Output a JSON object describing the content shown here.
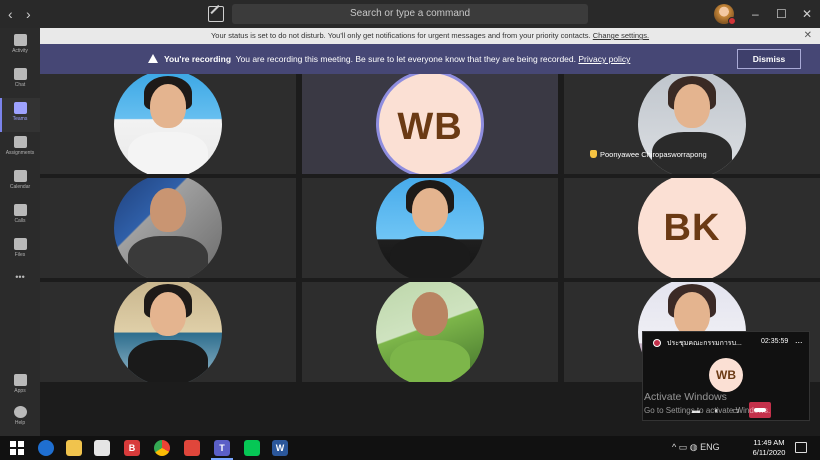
{
  "titlebar": {
    "back_icon": "‹",
    "forward_icon": "›",
    "search_placeholder": "Search or type a command",
    "minimize": "–",
    "maximize": "☐",
    "close": "✕"
  },
  "rail": {
    "items": [
      {
        "label": "Activity"
      },
      {
        "label": "Chat"
      },
      {
        "label": "Teams"
      },
      {
        "label": "Assignments"
      },
      {
        "label": "Calendar"
      },
      {
        "label": "Calls"
      },
      {
        "label": "Files"
      }
    ],
    "more": "•••",
    "apps": "Apps",
    "help": "Help"
  },
  "banner": {
    "text": "Your status is set to do not disturb. You'll only get notifications for urgent messages and from your priority contacts.",
    "link": "Change settings.",
    "close": "✕"
  },
  "recording": {
    "title": "You're recording",
    "text": "You are recording this meeting. Be sure to let everyone know that they are being recorded.",
    "link": "Privacy policy",
    "dismiss": "Dismiss"
  },
  "participants": {
    "wb": "WB",
    "bk": "BK",
    "raised_name": "Poonyawee Chiropasworrapong"
  },
  "mini": {
    "title": "ประชุมคณะกรรมการบ...",
    "time": "02:35:59",
    "more": "...",
    "initials": "WB"
  },
  "watermark": {
    "line1": "Activate Windows",
    "line2": "Go to Settings to activate Windows."
  },
  "taskbar": {
    "tray": "^  ▭  ◍  ENG",
    "time": "11:49 AM",
    "date": "6/11/2020"
  },
  "colors": {
    "teams_purple": "#464775",
    "accent": "#7b83eb",
    "recording_red": "#c4314b",
    "initials_bg": "#fbe0d4"
  }
}
